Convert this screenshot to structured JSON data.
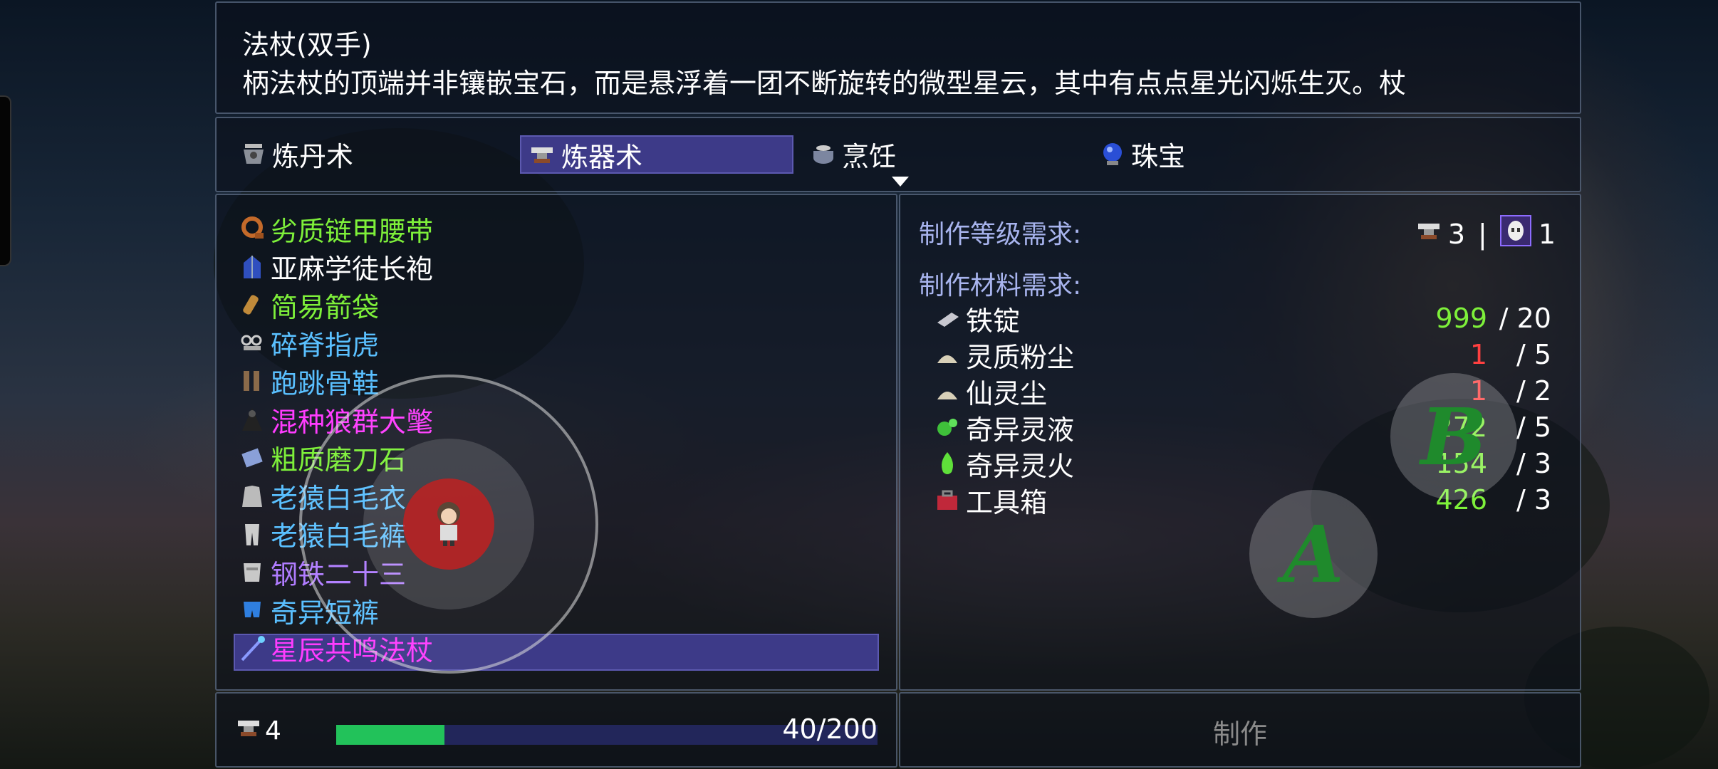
{
  "description": {
    "title": "法杖(双手)",
    "text": "柄法杖的顶端并非镶嵌宝石，而是悬浮着一团不断旋转的微型星云，其中有点点星光闪烁生灭。杖"
  },
  "tabs": [
    {
      "label": "炼丹术",
      "icon": "alchemy-cauldron-icon"
    },
    {
      "label": "炼器术",
      "icon": "anvil-icon",
      "selected": true
    },
    {
      "label": "烹饪",
      "icon": "cooking-pot-icon"
    },
    {
      "label": "珠宝",
      "icon": "blue-orb-icon"
    }
  ],
  "items": [
    {
      "label": "劣质链甲腰带",
      "color": "#7ef03a",
      "icon": "belt-icon"
    },
    {
      "label": "亚麻学徒长袍",
      "color": "#ffffff",
      "icon": "robe-icon"
    },
    {
      "label": "简易箭袋",
      "color": "#7ef03a",
      "icon": "quiver-icon"
    },
    {
      "label": "碎脊指虎",
      "color": "#5ac0ff",
      "icon": "knuckles-icon"
    },
    {
      "label": "跑跳骨鞋",
      "color": "#5ac0ff",
      "icon": "boots-icon"
    },
    {
      "label": "混种狼群大氅",
      "color": "#ff3cff",
      "icon": "cloak-icon"
    },
    {
      "label": "粗质磨刀石",
      "color": "#7ef03a",
      "icon": "whetstone-icon"
    },
    {
      "label": "老猿白毛衣",
      "color": "#5ac0ff",
      "icon": "coat-icon"
    },
    {
      "label": "老猿白毛裤",
      "color": "#5ac0ff",
      "icon": "pants-icon"
    },
    {
      "label": "钢铁二十三",
      "color": "#b07cff",
      "icon": "armor-icon"
    },
    {
      "label": "奇异短裤",
      "color": "#5ac0ff",
      "icon": "shorts-icon"
    },
    {
      "label": "星辰共鸣法杖",
      "color": "#ff3cff",
      "icon": "staff-icon",
      "selected": true
    }
  ],
  "requirements": {
    "level_heading": "制作等级需求:",
    "level_values": {
      "anvil": "3",
      "separator": "|",
      "mask": "1"
    },
    "materials_heading": "制作材料需求:",
    "materials": [
      {
        "name": "铁锭",
        "have": "999",
        "need": "/ 20",
        "have_color": "#7ef03a",
        "icon": "iron-ingot-icon"
      },
      {
        "name": "灵质粉尘",
        "have": "1",
        "need": "/ 5",
        "have_color": "#ff4040",
        "icon": "dust-pile-icon"
      },
      {
        "name": "仙灵尘",
        "have": "1",
        "need": "/ 2",
        "have_color": "#ff4040",
        "icon": "dust-pile-icon"
      },
      {
        "name": "奇异灵液",
        "have": "272",
        "need": "/ 5",
        "have_color": "#7ef03a",
        "icon": "green-liquid-icon"
      },
      {
        "name": "奇异灵火",
        "have": "154",
        "need": "/ 3",
        "have_color": "#7ef03a",
        "icon": "green-flame-icon"
      },
      {
        "name": "工具箱",
        "have": "426",
        "need": "/ 3",
        "have_color": "#7ef03a",
        "icon": "toolbox-icon"
      }
    ]
  },
  "status": {
    "level": "4",
    "exp_text": "40/200",
    "exp_fraction": 0.2
  },
  "craft_button": "制作",
  "controls": {
    "a_label": "A",
    "b_label": "B"
  },
  "colors": {
    "selection": "#3d3a88",
    "heading": "#a8b4ee",
    "exp_fill": "#22c25a"
  }
}
